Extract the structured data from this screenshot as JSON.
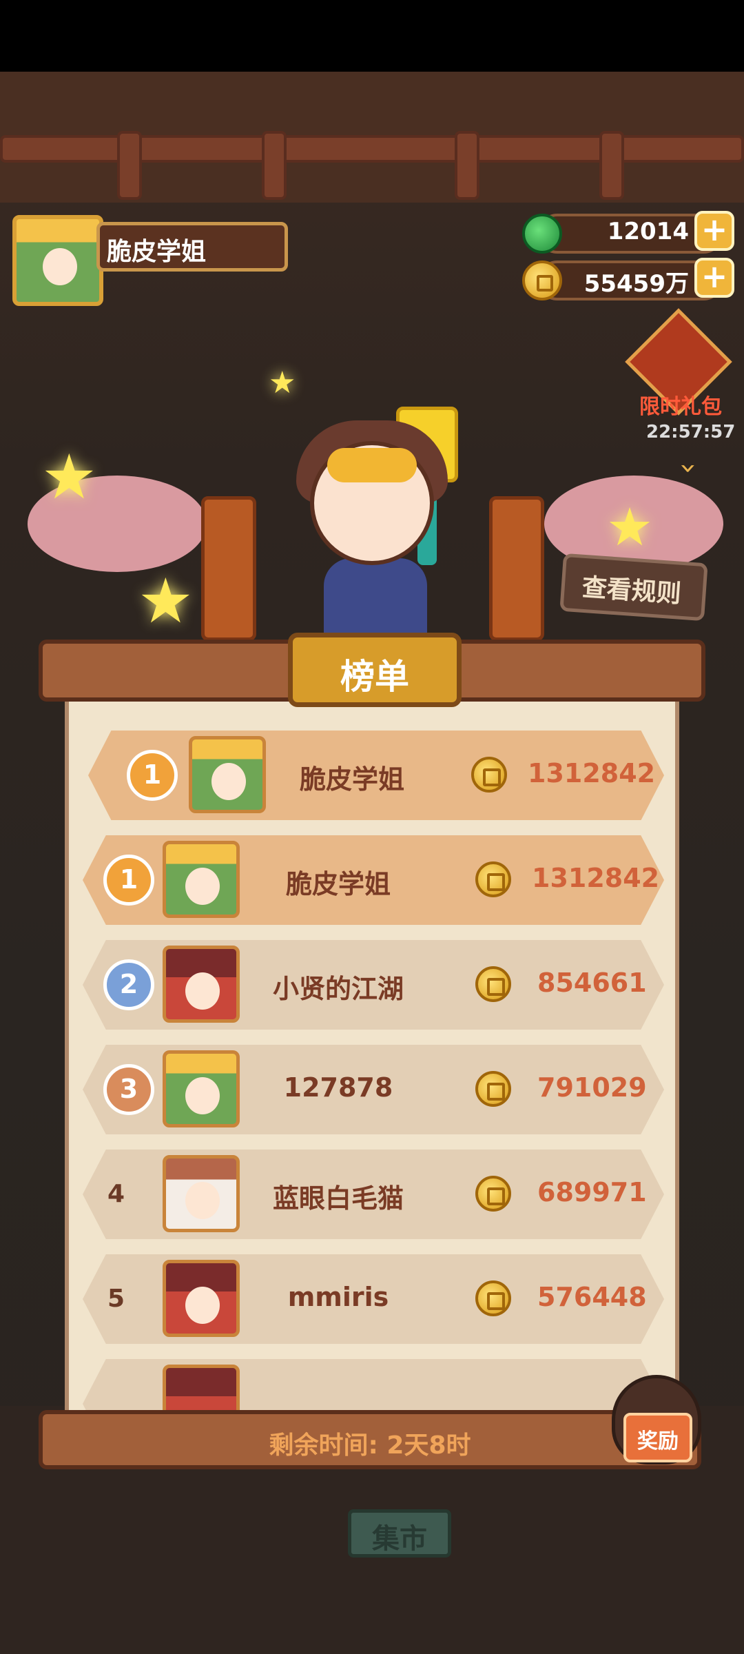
{
  "header": {
    "player_name": "脆皮学姐",
    "gems": "12014",
    "coins": "55459万"
  },
  "gift": {
    "label": "限时礼包",
    "timer": "22:57:57"
  },
  "rules_button": "查看规则",
  "board": {
    "title": "榜单",
    "my_rank": {
      "rank": "1",
      "name": "脆皮学姐",
      "score": "1312842"
    },
    "rows": [
      {
        "rank": "1",
        "name": "脆皮学姐",
        "score": "1312842",
        "avatar": "green"
      },
      {
        "rank": "2",
        "name": "小贤的江湖",
        "score": "854661",
        "avatar": "red"
      },
      {
        "rank": "3",
        "name": "127878",
        "score": "791029",
        "avatar": "green"
      },
      {
        "rank": "4",
        "name": "蓝眼白毛猫",
        "score": "689971",
        "avatar": "white"
      },
      {
        "rank": "5",
        "name": "mmiris",
        "score": "576448",
        "avatar": "red"
      }
    ]
  },
  "footer": {
    "remaining": "剩余时间: 2天8时",
    "reward_label": "奖励",
    "market_label": "集市"
  }
}
